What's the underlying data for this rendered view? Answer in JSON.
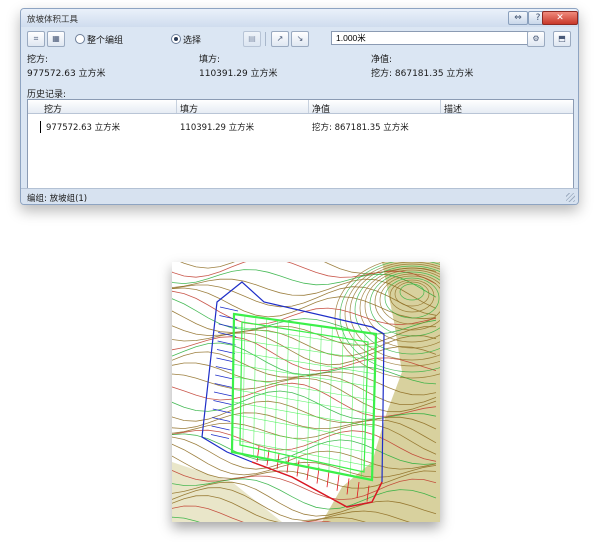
{
  "window": {
    "title": "放坡体积工具",
    "controls": {
      "help": "?",
      "pin": "⇔",
      "close": "✕"
    }
  },
  "toolbar": {
    "radio_whole_group": "整个编组",
    "radio_select": "选择",
    "selected_option": "选择",
    "step_value": "1.000米"
  },
  "summary": {
    "cut_label": "挖方:",
    "fill_label": "填方:",
    "net_label": "净值:",
    "cut_value": "977572.63 立方米",
    "fill_value": "110391.29 立方米",
    "net_value": "挖方: 867181.35 立方米"
  },
  "history": {
    "label": "历史记录:",
    "columns": [
      "挖方",
      "填方",
      "净值",
      "描述"
    ],
    "rows": [
      {
        "cut": "977572.63 立方米",
        "fill": "110391.29 立方米",
        "net": "挖方: 867181.35 立方米",
        "desc": ""
      }
    ]
  },
  "status": {
    "text": "编组: 放坡组(1)"
  },
  "map": {
    "colors": {
      "contour_dark": "#8c6a1e",
      "contour_red": "#c0392b",
      "contour_green": "#27ae3a",
      "grading_blue": "#1e2ec8",
      "grading_red": "#e0181e",
      "grading_green": "#3cf04a",
      "terrain_olive": "#a89a28"
    }
  }
}
